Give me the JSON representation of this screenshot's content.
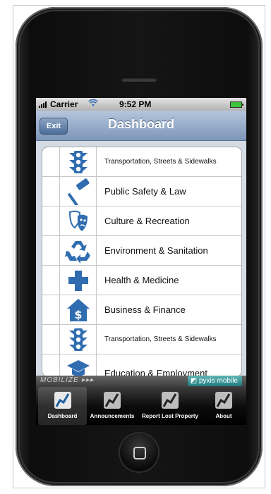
{
  "status_bar": {
    "carrier": "Carrier",
    "time": "9:52 PM"
  },
  "nav_bar": {
    "exit_label": "Exit",
    "title": "Dashboard"
  },
  "menu": {
    "items": [
      {
        "label": "Transportation, Streets & Sidewalks",
        "icon": "traffic-light-icon"
      },
      {
        "label": "Public Safety & Law",
        "icon": "gavel-icon"
      },
      {
        "label": "Culture & Recreation",
        "icon": "theater-masks-icon"
      },
      {
        "label": "Environment & Sanitation",
        "icon": "recycle-icon"
      },
      {
        "label": "Health & Medicine",
        "icon": "medical-cross-icon"
      },
      {
        "label": "Business & Finance",
        "icon": "dollar-house-icon"
      },
      {
        "label": "Transportation, Streets & Sidewalks",
        "icon": "traffic-light-icon"
      },
      {
        "label": "Education & Employment",
        "icon": "graduation-cap-icon"
      }
    ]
  },
  "branding": {
    "mobilize": "MOBILIZE",
    "pyxis": "pyxis mobile"
  },
  "tab_bar": {
    "tabs": [
      {
        "label": "Dashboard",
        "active": true
      },
      {
        "label": "Announcements",
        "active": false
      },
      {
        "label": "Report Lost Property",
        "active": false
      },
      {
        "label": "About",
        "active": false
      }
    ]
  },
  "colors": {
    "nav_gradient_top": "#b5c6dc",
    "nav_gradient_bottom": "#7d96b9",
    "icon_blue": "#2f6db0",
    "pyxis_teal": "#1f7a80"
  }
}
